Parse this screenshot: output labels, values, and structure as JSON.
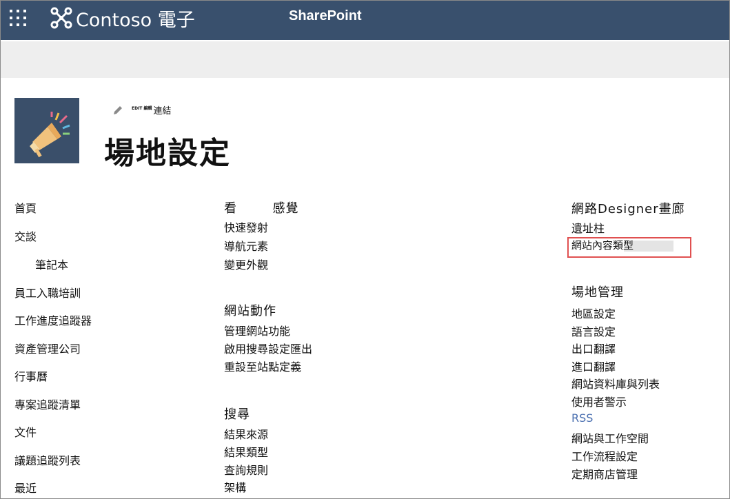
{
  "suite": {
    "brand": "Contoso 電子",
    "app": "SharePoint"
  },
  "site": {
    "edit_tiny": "EDIT 編輯",
    "edit_link": "連結",
    "title": "場地設定"
  },
  "nav": [
    "首頁",
    "交談",
    "筆記本",
    "員工入職培訓",
    "工作進度追蹤器",
    "資產管理公司",
    "行事曆",
    "專案追蹤清單",
    "文件",
    "議題追蹤列表",
    "最近"
  ],
  "look_feel": {
    "heading": "看 　　 感覺",
    "links": [
      "快速發射",
      "導航元素",
      "變更外觀"
    ]
  },
  "site_actions": {
    "heading": "網站動作",
    "links": [
      "管理網站功能",
      "啟用搜尋設定匯出",
      "重設至站點定義"
    ]
  },
  "search": {
    "heading": "搜尋",
    "links": [
      "結果來源",
      "結果類型",
      "查詢規則",
      "架構"
    ]
  },
  "web_designer": {
    "heading": "網路Designer畫廊",
    "links": [
      "遺址柱",
      "網站內容類型"
    ]
  },
  "site_admin": {
    "heading": "場地管理",
    "links": [
      "地區設定",
      "語言設定",
      "出口翻譯",
      "進口翻譯",
      "網站資料庫與列表",
      "使用者警示",
      "RSS",
      "網站與工作空間",
      "工作流程設定",
      "定期商店管理"
    ]
  },
  "colors": {
    "suite_bar": "#39506d",
    "logo_bg": "#3a4f6a",
    "highlight": "#e05050",
    "rss": "#4a6fb0"
  },
  "icons": [
    "app-launcher-icon",
    "contoso-logo-icon",
    "pencil-icon",
    "megaphone-logo-icon"
  ]
}
